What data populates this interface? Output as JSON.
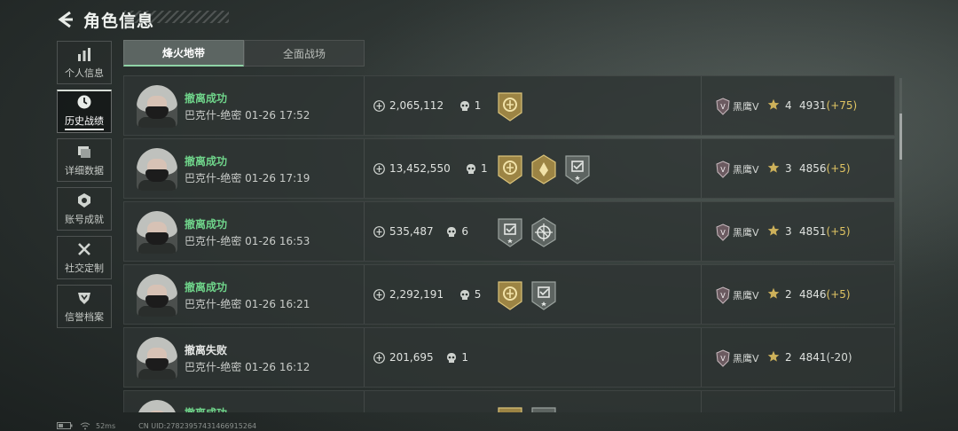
{
  "header": {
    "title": "角色信息"
  },
  "sidebar": {
    "items": [
      {
        "label": "个人信息",
        "icon": "bar-chart-icon",
        "active": false
      },
      {
        "label": "历史战绩",
        "icon": "clock-icon",
        "active": true
      },
      {
        "label": "详细数据",
        "icon": "cards-icon",
        "active": false
      },
      {
        "label": "账号成就",
        "icon": "medal-icon",
        "active": false
      },
      {
        "label": "社交定制",
        "icon": "tools-icon",
        "active": false
      },
      {
        "label": "信誉档案",
        "icon": "shield-icon",
        "active": false
      }
    ]
  },
  "tabs": [
    {
      "label": "烽火地带",
      "active": true
    },
    {
      "label": "全面战场",
      "active": false
    }
  ],
  "colors": {
    "success": "#6fd48a",
    "delta_positive": "#e0c463",
    "badge_gold": "#b89a4a",
    "badge_gray": "#6c7370"
  },
  "rows": [
    {
      "status": "撤离成功",
      "success": true,
      "map": "巴克什-绝密",
      "time": "01-26 17:52",
      "money": "2,065,112",
      "kills": "1",
      "badges": [
        "gold-shield-badge"
      ],
      "rank_name": "黑鹰V",
      "stars": "4",
      "score": "4931",
      "delta": "(+75)"
    },
    {
      "status": "撤离成功",
      "success": true,
      "map": "巴克什-绝密",
      "time": "01-26 17:19",
      "money": "13,452,550",
      "kills": "1",
      "badges": [
        "gold-shield-badge",
        "gold-hexagon-badge",
        "gray-check-badge"
      ],
      "rank_name": "黑鹰V",
      "stars": "3",
      "score": "4856",
      "delta": "(+5)"
    },
    {
      "status": "撤离成功",
      "success": true,
      "map": "巴克什-绝密",
      "time": "01-26 16:53",
      "money": "535,487",
      "kills": "6",
      "badges": [
        "gray-check-badge",
        "gray-crosshair-badge"
      ],
      "rank_name": "黑鹰V",
      "stars": "3",
      "score": "4851",
      "delta": "(+5)"
    },
    {
      "status": "撤离成功",
      "success": true,
      "map": "巴克什-绝密",
      "time": "01-26 16:21",
      "money": "2,292,191",
      "kills": "5",
      "badges": [
        "gold-shield-badge",
        "gray-check-badge"
      ],
      "rank_name": "黑鹰V",
      "stars": "2",
      "score": "4846",
      "delta": "(+5)"
    },
    {
      "status": "撤离失败",
      "success": false,
      "map": "巴克什-绝密",
      "time": "01-26 16:12",
      "money": "201,695",
      "kills": "1",
      "badges": [],
      "rank_name": "黑鹰V",
      "stars": "2",
      "score": "4841",
      "delta": "(-20)"
    },
    {
      "status": "撤离成功",
      "success": true,
      "map": "",
      "time": "",
      "money": "",
      "kills": "",
      "badges": [
        "gold-shield-badge",
        "gray-check-badge"
      ],
      "rank_name": "",
      "stars": "",
      "score": "",
      "delta": ""
    }
  ],
  "footer": {
    "ping": "52ms",
    "uid": "CN UID:27823957431466915264"
  }
}
